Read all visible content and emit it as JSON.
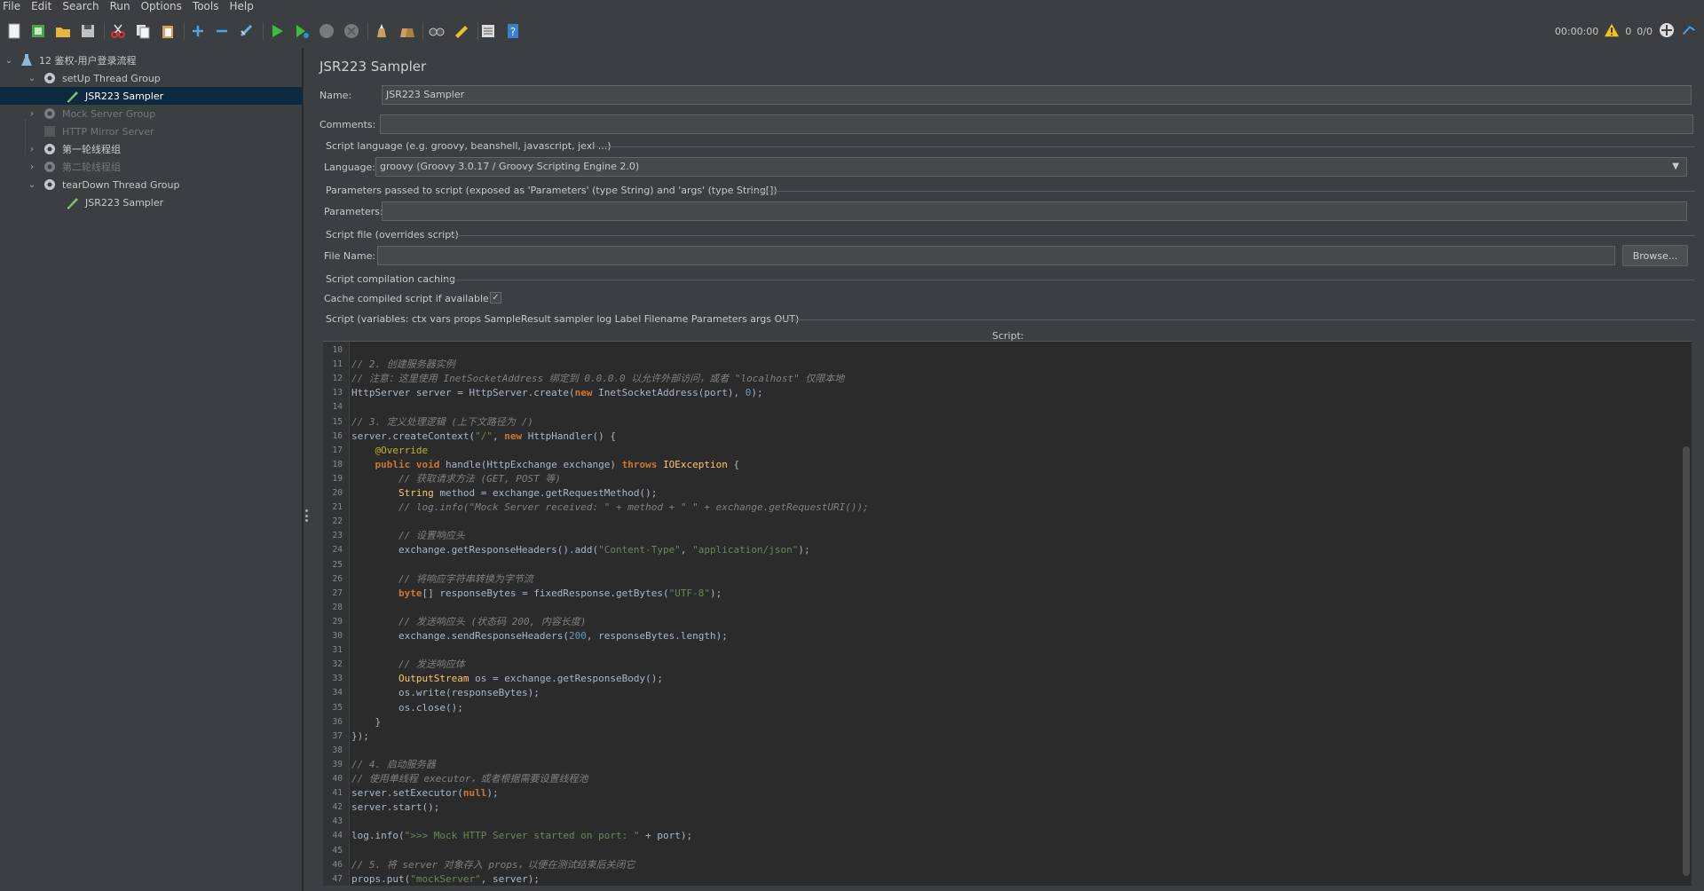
{
  "menu": [
    "File",
    "Edit",
    "Search",
    "Run",
    "Options",
    "Tools",
    "Help"
  ],
  "toolbar": {
    "buttons": [
      "new-icon",
      "templates-icon",
      "open-icon",
      "save-icon",
      "cut-icon",
      "copy-icon",
      "paste-icon",
      "expand-icon",
      "collapse-icon",
      "toggle-icon",
      "start-icon",
      "start-no-pauses-icon",
      "stop-icon",
      "shutdown-icon",
      "clear-icon",
      "clear-all-icon",
      "search-icon",
      "reset-search-icon",
      "function-helper-icon",
      "help-icon"
    ],
    "timer": "00:00:00",
    "warning_count": "0",
    "threads": "0/0"
  },
  "tree": {
    "items": [
      {
        "label": "12 鉴权-用户登录流程",
        "icon": "test-plan-icon",
        "level": 0,
        "expand": "open",
        "state": "normal"
      },
      {
        "label": "setUp Thread Group",
        "icon": "gear-icon",
        "level": 1,
        "expand": "open",
        "state": "normal"
      },
      {
        "label": "JSR223 Sampler",
        "icon": "sampler-pen-icon",
        "level": 2,
        "expand": "none",
        "state": "selected"
      },
      {
        "label": "Mock Server Group",
        "icon": "gear-icon",
        "level": 1,
        "expand": "closed",
        "state": "disabled"
      },
      {
        "label": "HTTP Mirror Server",
        "icon": "server-icon",
        "level": 1,
        "expand": "none",
        "state": "disabled"
      },
      {
        "label": "第一轮线程组",
        "icon": "gear-icon",
        "level": 1,
        "expand": "closed",
        "state": "normal"
      },
      {
        "label": "第二轮线程组",
        "icon": "gear-icon",
        "level": 1,
        "expand": "closed",
        "state": "disabled"
      },
      {
        "label": "tearDown Thread Group",
        "icon": "gear-icon",
        "level": 1,
        "expand": "open",
        "state": "normal"
      },
      {
        "label": "JSR223 Sampler",
        "icon": "sampler-pen-icon",
        "level": 2,
        "expand": "none",
        "state": "normal"
      }
    ]
  },
  "panel": {
    "title": "JSR223 Sampler",
    "name_label": "Name:",
    "name_value": "JSR223 Sampler",
    "comments_label": "Comments:",
    "comments_value": "",
    "script_language_section": "Script language (e.g. groovy, beanshell, javascript, jexl ...)",
    "language_label": "Language:",
    "language_value": "groovy     (Groovy 3.0.17 / Groovy Scripting Engine 2.0)",
    "parameters_section": "Parameters passed to script (exposed as 'Parameters' (type String) and 'args' (type String[])",
    "parameters_label": "Parameters:",
    "parameters_value": "",
    "script_file_section": "Script file (overrides script)",
    "file_name_label": "File Name:",
    "file_name_value": "",
    "browse_label": "Browse...",
    "caching_section": "Script compilation caching",
    "cache_label": "Cache compiled script if available:",
    "cache_checked": "✓",
    "script_section": "Script (variables: ctx vars props SampleResult sampler log Label Filename Parameters args OUT)",
    "script_header": "Script:"
  },
  "editor": {
    "lines": [
      {
        "n": "10",
        "t": []
      },
      {
        "n": "11",
        "t": [
          [
            "comment",
            "// 2. 创建服务器实例"
          ]
        ]
      },
      {
        "n": "12",
        "t": [
          [
            "comment",
            "// 注意：这里使用 InetSocketAddress 绑定到 0.0.0.0 以允许外部访问，或者 \"localhost\" 仅限本地"
          ]
        ]
      },
      {
        "n": "13",
        "t": [
          [
            "plain",
            "HttpServer server = HttpServer.create("
          ],
          [
            "keyword",
            "new"
          ],
          [
            "plain",
            " InetSocketAddress(port), "
          ],
          [
            "number",
            "0"
          ],
          [
            "plain",
            ");"
          ]
        ]
      },
      {
        "n": "14",
        "t": []
      },
      {
        "n": "15",
        "t": [
          [
            "comment",
            "// 3. 定义处理逻辑 (上下文路径为 /)"
          ]
        ]
      },
      {
        "n": "16",
        "t": [
          [
            "plain",
            "server.createContext("
          ],
          [
            "string",
            "\"/\""
          ],
          [
            "plain",
            ", "
          ],
          [
            "keyword",
            "new"
          ],
          [
            "plain",
            " HttpHandler() {"
          ]
        ]
      },
      {
        "n": "17",
        "t": [
          [
            "plain",
            "    "
          ],
          [
            "annotation",
            "@Override"
          ]
        ]
      },
      {
        "n": "18",
        "t": [
          [
            "plain",
            "    "
          ],
          [
            "keyword",
            "public"
          ],
          [
            "plain",
            " "
          ],
          [
            "keyword",
            "void"
          ],
          [
            "plain",
            " handle(HttpExchange exchange) "
          ],
          [
            "keyword",
            "throws"
          ],
          [
            "plain",
            " "
          ],
          [
            "type",
            "IOException"
          ],
          [
            "plain",
            " {"
          ]
        ]
      },
      {
        "n": "19",
        "t": [
          [
            "plain",
            "        "
          ],
          [
            "comment",
            "// 获取请求方法 (GET, POST 等)"
          ]
        ]
      },
      {
        "n": "20",
        "t": [
          [
            "plain",
            "        "
          ],
          [
            "type",
            "String"
          ],
          [
            "plain",
            " method = exchange.getRequestMethod();"
          ]
        ]
      },
      {
        "n": "21",
        "t": [
          [
            "plain",
            "        "
          ],
          [
            "comment",
            "// log.info(\"Mock Server received: \" + method + \" \" + exchange.getRequestURI());"
          ]
        ]
      },
      {
        "n": "22",
        "t": []
      },
      {
        "n": "23",
        "t": [
          [
            "plain",
            "        "
          ],
          [
            "comment",
            "// 设置响应头"
          ]
        ]
      },
      {
        "n": "24",
        "t": [
          [
            "plain",
            "        exchange.getResponseHeaders().add("
          ],
          [
            "string",
            "\"Content-Type\""
          ],
          [
            "plain",
            ", "
          ],
          [
            "string",
            "\"application/json\""
          ],
          [
            "plain",
            ");"
          ]
        ]
      },
      {
        "n": "25",
        "t": []
      },
      {
        "n": "26",
        "t": [
          [
            "plain",
            "        "
          ],
          [
            "comment",
            "// 将响应字符串转换为字节流"
          ]
        ]
      },
      {
        "n": "27",
        "t": [
          [
            "plain",
            "        "
          ],
          [
            "keyword",
            "byte"
          ],
          [
            "plain",
            "[] responseBytes = fixedResponse.getBytes("
          ],
          [
            "string",
            "\"UTF-8\""
          ],
          [
            "plain",
            ");"
          ]
        ]
      },
      {
        "n": "28",
        "t": []
      },
      {
        "n": "29",
        "t": [
          [
            "plain",
            "        "
          ],
          [
            "comment",
            "// 发送响应头 (状态码 200, 内容长度)"
          ]
        ]
      },
      {
        "n": "30",
        "t": [
          [
            "plain",
            "        exchange.sendResponseHeaders("
          ],
          [
            "number",
            "200"
          ],
          [
            "plain",
            ", responseBytes.length);"
          ]
        ]
      },
      {
        "n": "31",
        "t": []
      },
      {
        "n": "32",
        "t": [
          [
            "plain",
            "        "
          ],
          [
            "comment",
            "// 发送响应体"
          ]
        ]
      },
      {
        "n": "33",
        "t": [
          [
            "plain",
            "        "
          ],
          [
            "type",
            "OutputStream"
          ],
          [
            "plain",
            " os = exchange.getResponseBody();"
          ]
        ]
      },
      {
        "n": "34",
        "t": [
          [
            "plain",
            "        os.write(responseBytes);"
          ]
        ]
      },
      {
        "n": "35",
        "t": [
          [
            "plain",
            "        os.close();"
          ]
        ]
      },
      {
        "n": "36",
        "t": [
          [
            "plain",
            "    }"
          ]
        ]
      },
      {
        "n": "37",
        "t": [
          [
            "plain",
            "});"
          ]
        ]
      },
      {
        "n": "38",
        "t": []
      },
      {
        "n": "39",
        "t": [
          [
            "comment",
            "// 4. 启动服务器"
          ]
        ]
      },
      {
        "n": "40",
        "t": [
          [
            "comment",
            "// 使用单线程 executor，或者根据需要设置线程池"
          ]
        ]
      },
      {
        "n": "41",
        "t": [
          [
            "plain",
            "server.setExecutor("
          ],
          [
            "keyword",
            "null"
          ],
          [
            "plain",
            ");"
          ]
        ]
      },
      {
        "n": "42",
        "t": [
          [
            "plain",
            "server.start();"
          ]
        ]
      },
      {
        "n": "43",
        "t": []
      },
      {
        "n": "44",
        "t": [
          [
            "plain",
            "log.info("
          ],
          [
            "string",
            "\">>> Mock HTTP Server started on port: \""
          ],
          [
            "plain",
            " + port);"
          ]
        ]
      },
      {
        "n": "45",
        "t": []
      },
      {
        "n": "46",
        "t": [
          [
            "comment",
            "// 5. 将 server 对象存入 props，以便在测试结束后关闭它"
          ]
        ]
      },
      {
        "n": "47",
        "t": [
          [
            "plain",
            "props.put("
          ],
          [
            "string",
            "\"mockServer\""
          ],
          [
            "plain",
            ", server);"
          ]
        ]
      }
    ]
  }
}
